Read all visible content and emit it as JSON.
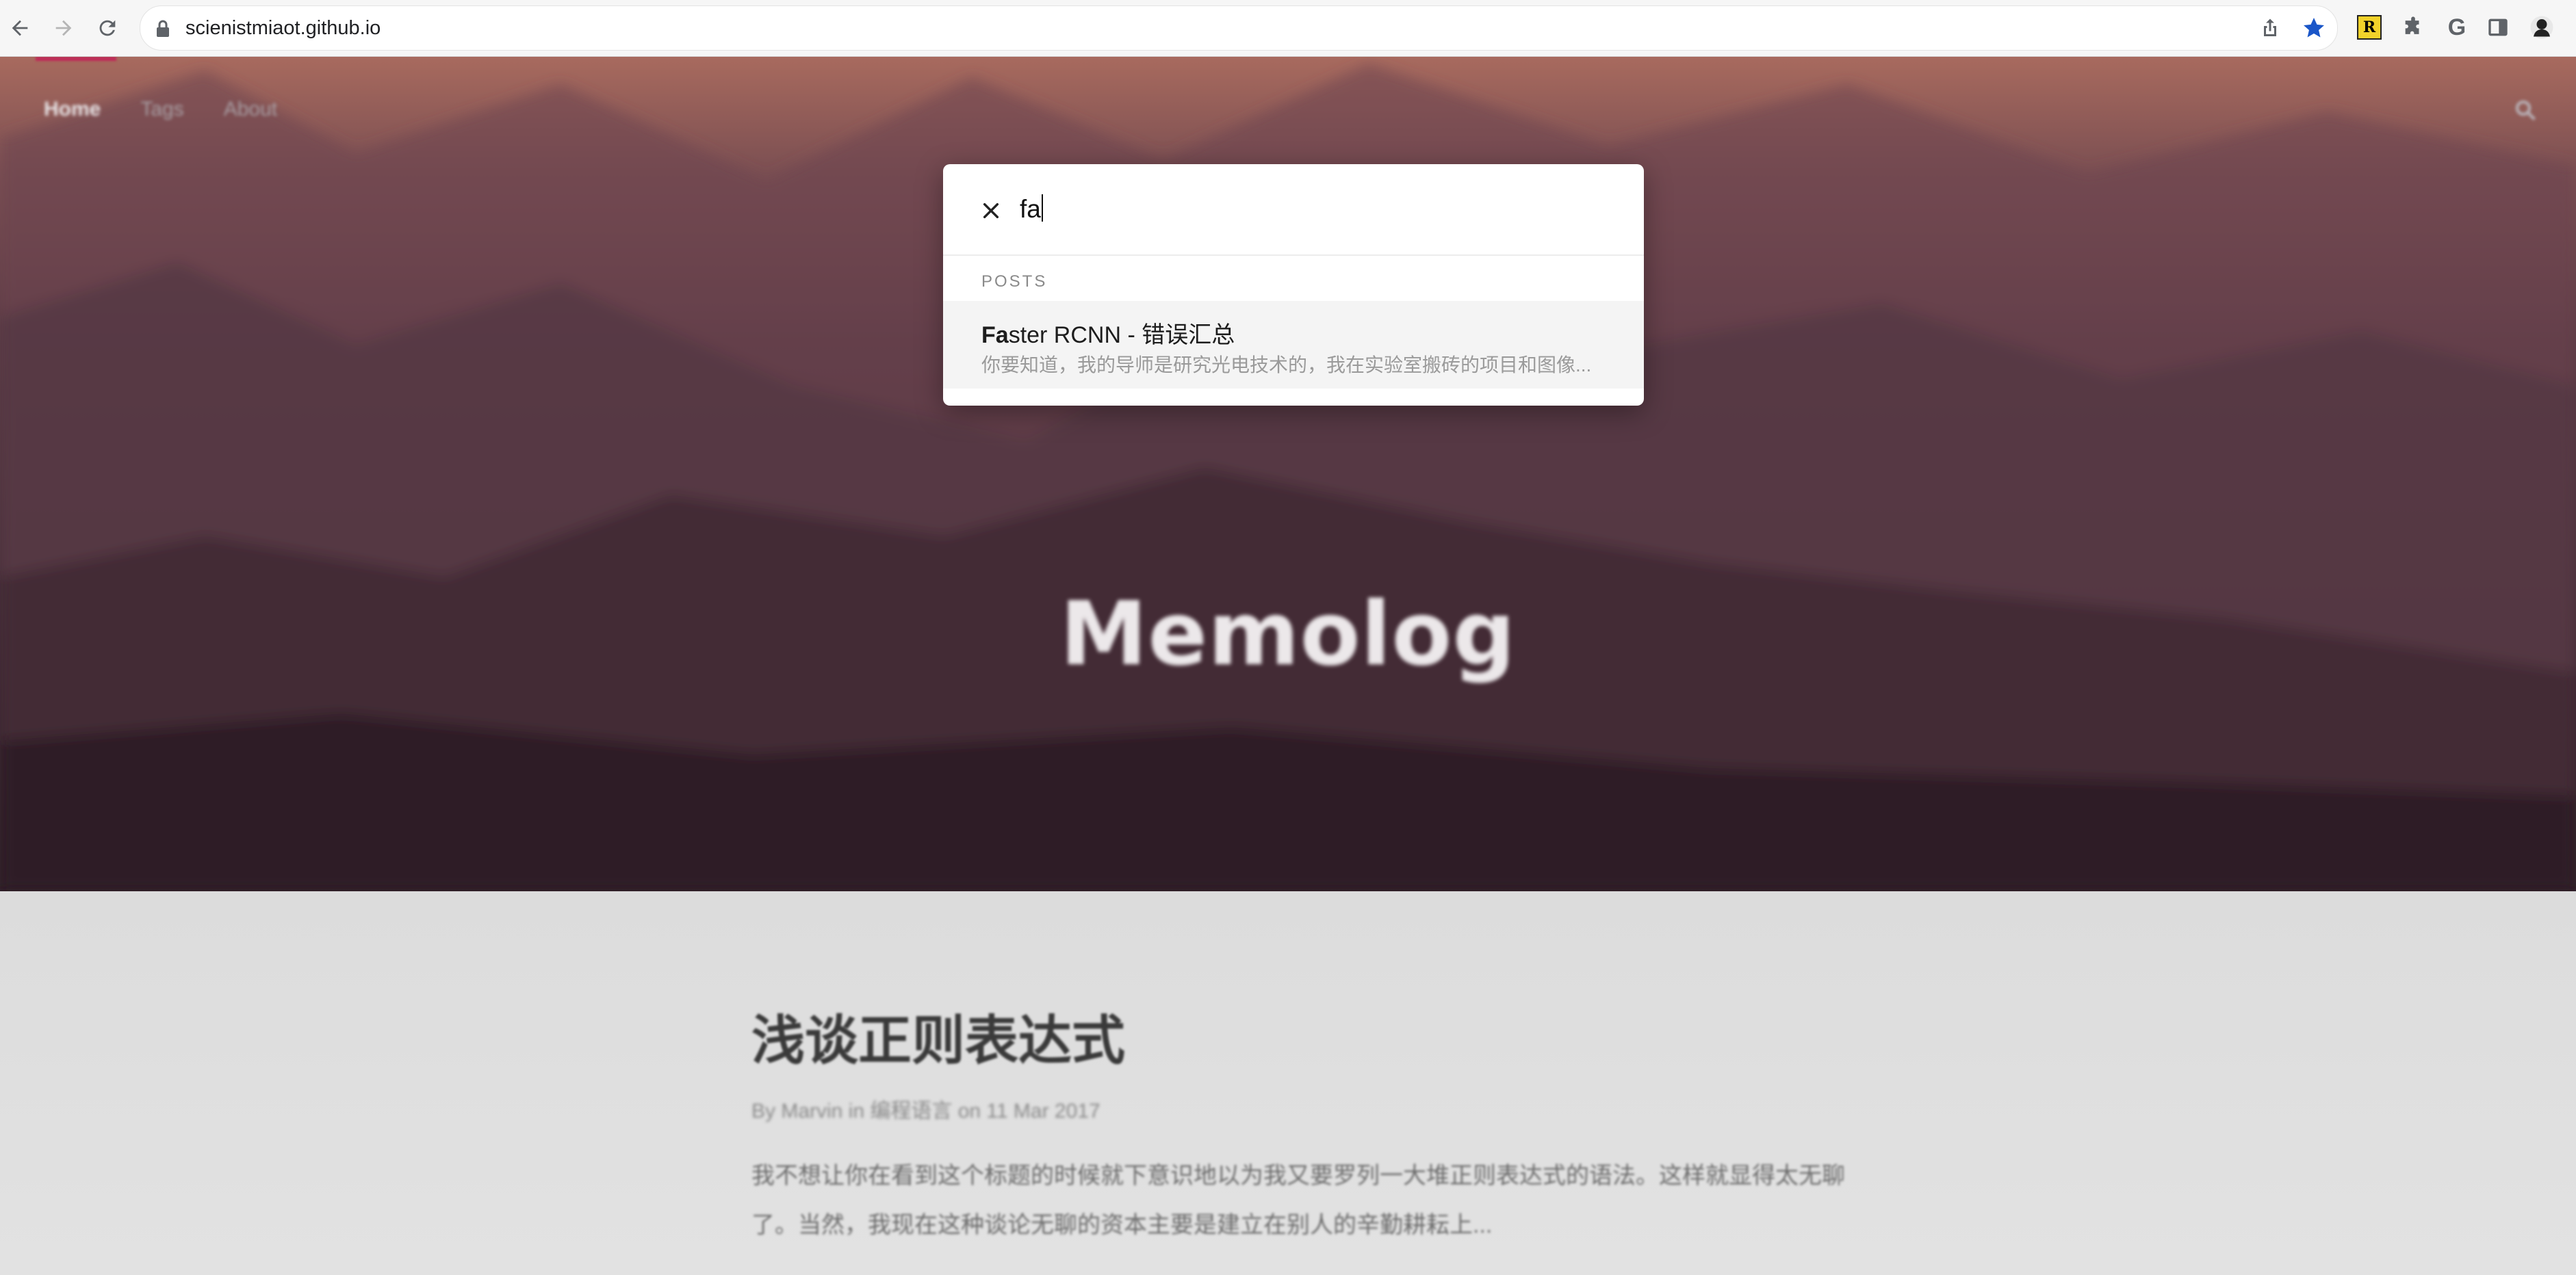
{
  "browser": {
    "url": "scienistmiaot.github.io"
  },
  "site": {
    "nav": [
      {
        "label": "Home",
        "active": true
      },
      {
        "label": "Tags",
        "active": false
      },
      {
        "label": "About",
        "active": false
      }
    ],
    "title": "Memolog"
  },
  "search": {
    "query": "fa",
    "section_label": "POSTS",
    "results": [
      {
        "title_match": "Fa",
        "title_rest": "ster RCNN - 错误汇总",
        "excerpt": "你要知道，我的导师是研究光电技术的，我在实验室搬砖的项目和图像..."
      }
    ]
  },
  "post": {
    "title": "浅谈正则表达式",
    "meta": "By Marvin in 编程语言 on 11 Mar 2017",
    "excerpt": "我不想让你在看到这个标题的时候就下意识地以为我又要罗列一大堆正则表达式的语法。这样就显得太无聊了。当然，我现在这种谈论无聊的资本主要是建立在别人的辛勤耕耘上..."
  },
  "colors": {
    "accent": "#c02858",
    "hero_top": "#a86a5e",
    "hero_bottom": "#2f1f27"
  }
}
